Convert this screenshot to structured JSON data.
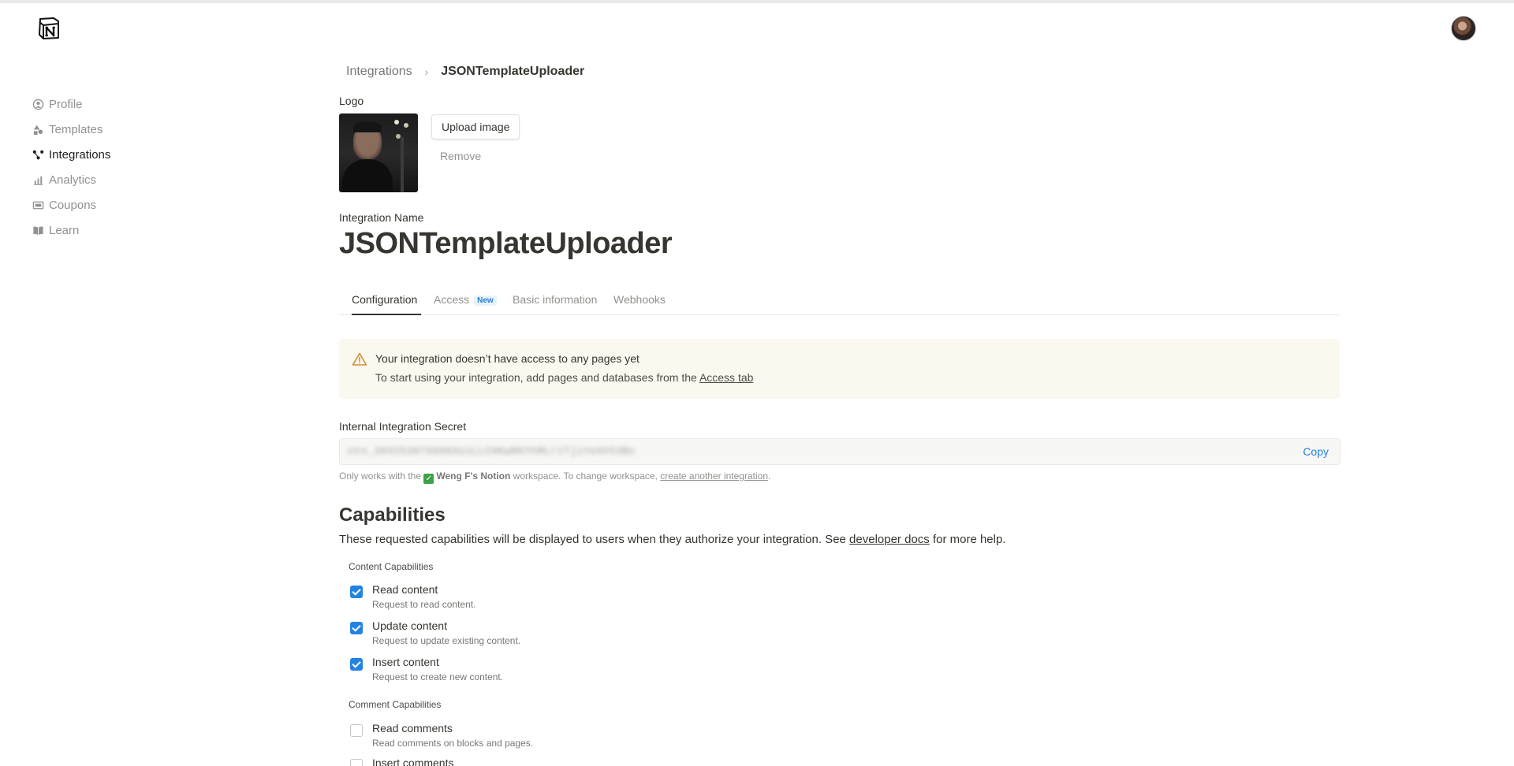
{
  "header": {
    "logo_icon": "notion-logo-icon",
    "avatar_icon": "user-avatar"
  },
  "sidebar": {
    "items": [
      {
        "label": "Profile",
        "icon": "person-circle-icon"
      },
      {
        "label": "Templates",
        "icon": "shapes-icon"
      },
      {
        "label": "Integrations",
        "icon": "nodes-icon",
        "active": true
      },
      {
        "label": "Analytics",
        "icon": "chart-icon"
      },
      {
        "label": "Coupons",
        "icon": "ticket-icon"
      },
      {
        "label": "Learn",
        "icon": "book-icon"
      }
    ]
  },
  "breadcrumb": {
    "parent": "Integrations",
    "separator": "›",
    "current": "JSONTemplateUploader"
  },
  "logo_section": {
    "label": "Logo",
    "upload_label": "Upload image",
    "remove_label": "Remove"
  },
  "integration": {
    "name_label": "Integration Name",
    "name": "JSONTemplateUploader"
  },
  "tabs": [
    {
      "label": "Configuration",
      "active": true
    },
    {
      "label": "Access",
      "badge": "New"
    },
    {
      "label": "Basic information"
    },
    {
      "label": "Webhooks"
    }
  ],
  "warning": {
    "icon": "warning-triangle-icon",
    "title": "Your integration doesn’t have access to any pages yet",
    "text_before": "To start using your integration, add pages and databases from the ",
    "link": "Access tab"
  },
  "secret": {
    "label": "Internal Integration Secret",
    "value": "ntn_394253075896Ao1LLCHKwRKYhMLr1TjiYeAV53Bc",
    "copy_label": "Copy"
  },
  "workspace_note": {
    "prefix": "Only works with the ",
    "emoji": "✓",
    "workspace": "Weng F's Notion",
    "middle": " workspace. To change workspace, ",
    "link": "create another integration",
    "suffix": "."
  },
  "capabilities": {
    "title": "Capabilities",
    "desc_before": "These requested capabilities will be displayed to users when they authorize your integration. See ",
    "desc_link": "developer docs",
    "desc_after": " for more help.",
    "content_label": "Content Capabilities",
    "content": [
      {
        "name": "Read content",
        "desc": "Request to read content.",
        "checked": true
      },
      {
        "name": "Update content",
        "desc": "Request to update existing content.",
        "checked": true
      },
      {
        "name": "Insert content",
        "desc": "Request to create new content.",
        "checked": true
      }
    ],
    "comment_label": "Comment Capabilities",
    "comments": [
      {
        "name": "Read comments",
        "desc": "Read comments on blocks and pages.",
        "checked": false
      },
      {
        "name": "Insert comments",
        "desc": "",
        "checked": false
      }
    ]
  },
  "colors": {
    "accent": "#2383e2",
    "warning_bg": "#fbf8ef",
    "text": "#37352f",
    "muted": "#91918e"
  }
}
